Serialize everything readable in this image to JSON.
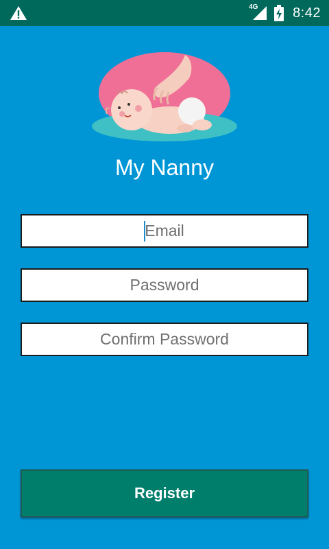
{
  "status_bar": {
    "network_type": "4G",
    "time": "8:42",
    "icons": [
      "warning-icon",
      "signal-icon",
      "battery-charging-icon"
    ]
  },
  "app": {
    "title": "My Nanny",
    "logo": "baby-massage-logo"
  },
  "form": {
    "email": {
      "placeholder": "Email",
      "value": ""
    },
    "password": {
      "placeholder": "Password",
      "value": ""
    },
    "confirm_password": {
      "placeholder": "Confirm Password",
      "value": ""
    }
  },
  "actions": {
    "register_label": "Register"
  },
  "colors": {
    "background": "#0096D6",
    "status_bar": "#00695C",
    "button": "#007E6C"
  }
}
